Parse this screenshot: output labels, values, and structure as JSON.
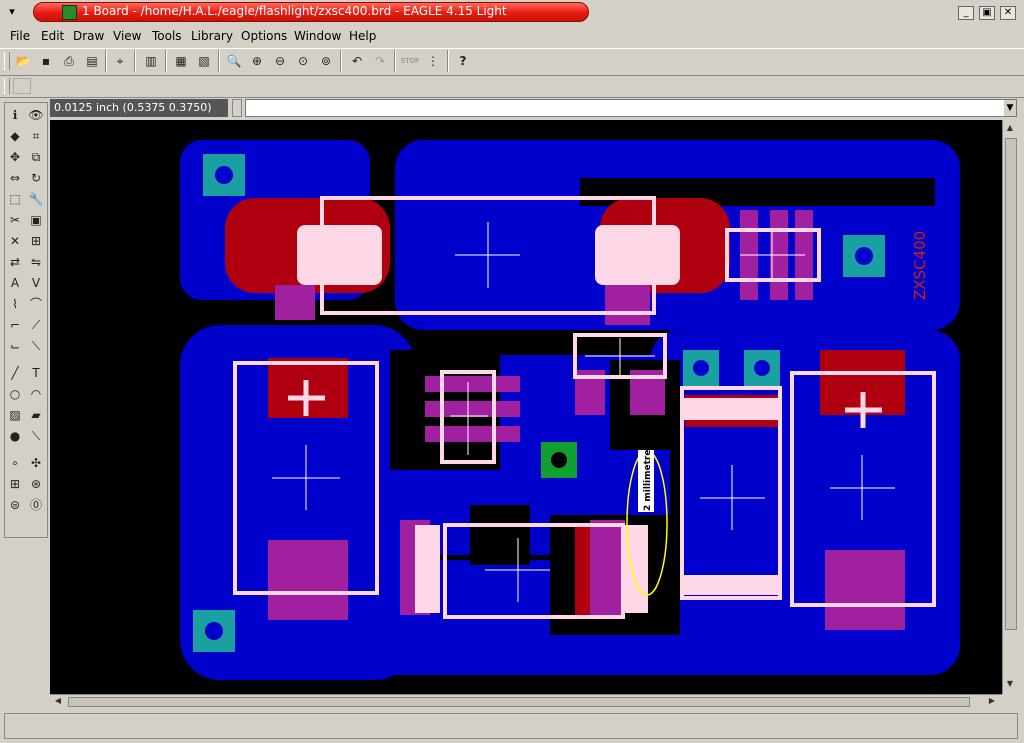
{
  "window": {
    "title": "1 Board - /home/H.A.L./eagle/flashlight/zxsc400.brd - EAGLE 4.15 Light"
  },
  "menu": [
    "File",
    "Edit",
    "Draw",
    "View",
    "Tools",
    "Library",
    "Options",
    "Window",
    "Help"
  ],
  "coordinate_readout": "0.0125 inch (0.5375 0.3750)",
  "board": {
    "silkscreen_label": "ZXSC400",
    "annotation_text": "2 millimetres"
  },
  "colors": {
    "background": "#000000",
    "bottom_copper": "#0000cc",
    "top_copper": "#b00010",
    "pads": "#1aa0a0",
    "smd": "#a020a0",
    "silkscreen": "#ffd8e8",
    "annotation": "#ffff00"
  },
  "icons": {
    "toolbar": [
      "open-icon",
      "save-icon",
      "print-icon",
      "cam-icon",
      "script-icon",
      "ulp-icon",
      "board-icon",
      "schematic-icon",
      "zoom-fit-icon",
      "zoom-in-icon",
      "zoom-out-icon",
      "zoom-redraw-icon",
      "zoom-select-icon",
      "undo-icon",
      "redo-icon",
      "stop-icon",
      "go-icon",
      "help-icon"
    ],
    "palette": [
      "info-icon",
      "show-icon",
      "display-icon",
      "mark-icon",
      "move-icon",
      "copy-icon",
      "mirror-icon",
      "rotate-icon",
      "group-icon",
      "change-icon",
      "cut-icon",
      "paste-icon",
      "delete-icon",
      "add-icon",
      "pinswap-icon",
      "replace-icon",
      "name-icon",
      "value-icon",
      "smash-icon",
      "miter-icon",
      "split-icon",
      "optimize-icon",
      "route-icon",
      "ripup-icon",
      "wire-icon",
      "text-icon",
      "circle-icon",
      "arc-icon",
      "rect-icon",
      "polygon-icon",
      "via-icon",
      "signal-icon",
      "hole-icon",
      "ratsnest-icon",
      "autorouter-icon",
      "drc-icon",
      "errors-icon",
      "erc-icon"
    ]
  }
}
